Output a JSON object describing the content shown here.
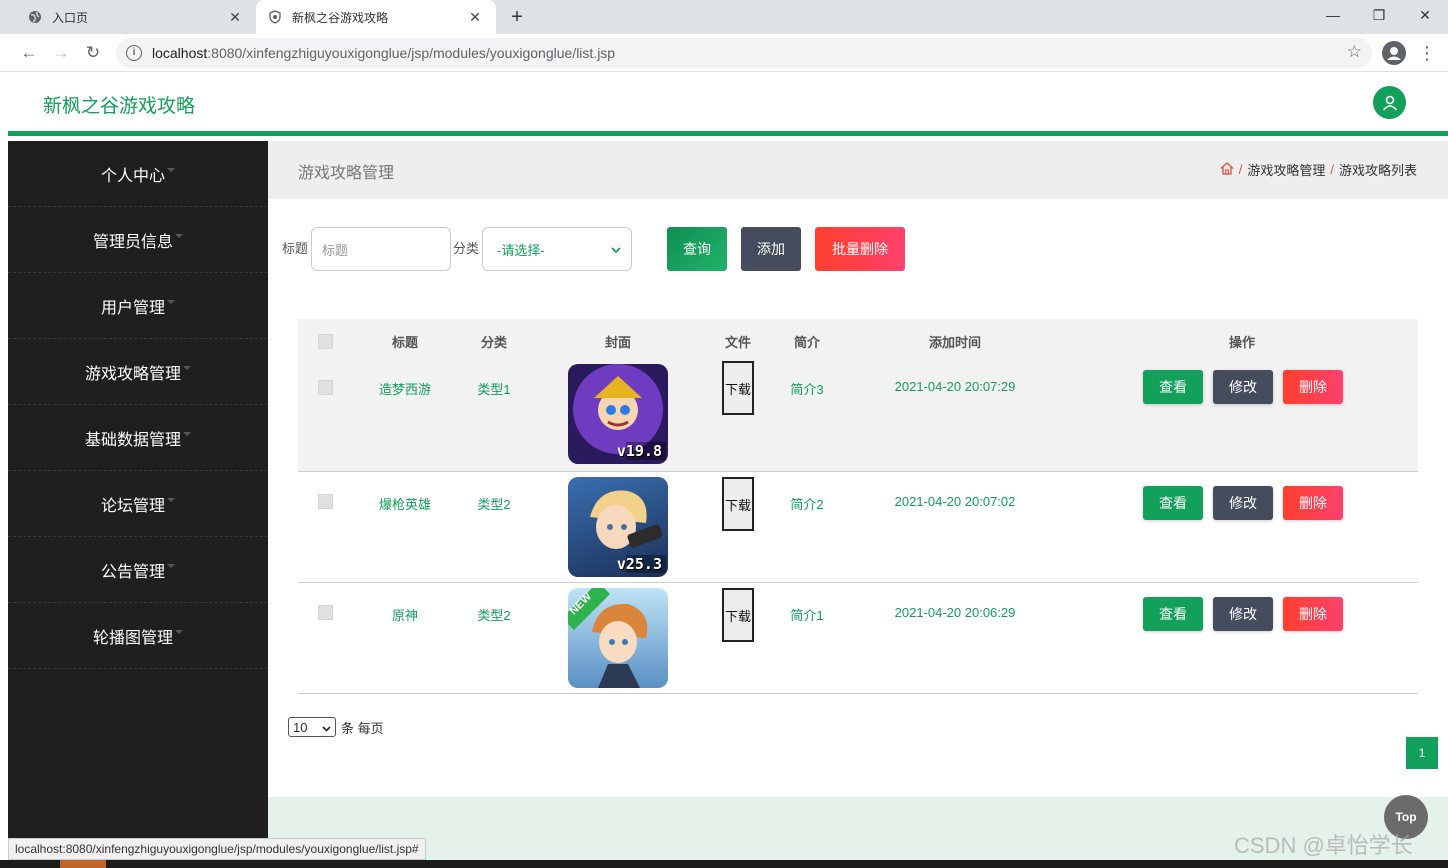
{
  "browser": {
    "tabs": [
      {
        "label": "入口页",
        "active": false
      },
      {
        "label": "新枫之谷游戏攻略",
        "active": true
      }
    ],
    "url_host": "localhost",
    "url_rest": ":8080/xinfengzhiguyouxigonglue/jsp/modules/youxigonglue/list.jsp",
    "status_url": "localhost:8080/xinfengzhiguyouxigonglue/jsp/modules/youxigonglue/list.jsp#"
  },
  "header": {
    "app_title": "新枫之谷游戏攻略"
  },
  "sidebar": {
    "items": [
      {
        "label": "个人中心"
      },
      {
        "label": "管理员信息"
      },
      {
        "label": "用户管理"
      },
      {
        "label": "游戏攻略管理"
      },
      {
        "label": "基础数据管理"
      },
      {
        "label": "论坛管理"
      },
      {
        "label": "公告管理"
      },
      {
        "label": "轮播图管理"
      }
    ]
  },
  "page": {
    "title": "游戏攻略管理",
    "breadcrumb": [
      "游戏攻略管理",
      "游戏攻略列表"
    ]
  },
  "search": {
    "title_label": "标题",
    "title_placeholder": "标题",
    "category_label": "分类",
    "category_value": "-请选择-",
    "query_button": "查询",
    "add_button": "添加",
    "batch_delete_button": "批量删除"
  },
  "table": {
    "headers": [
      "标题",
      "分类",
      "封面",
      "文件",
      "简介",
      "添加时间",
      "操作"
    ],
    "download_label": "下载",
    "actions": {
      "view": "查看",
      "edit": "修改",
      "delete": "删除"
    },
    "rows": [
      {
        "title": "造梦西游",
        "category": "类型1",
        "cover_badge": "v19.8",
        "summary": "简介3",
        "added": "2021-04-20 20:07:29"
      },
      {
        "title": "爆枪英雄",
        "category": "类型2",
        "cover_badge": "v25.3",
        "summary": "简介2",
        "added": "2021-04-20 20:07:02"
      },
      {
        "title": "原神",
        "category": "类型2",
        "cover_badge": "NEW",
        "summary": "简介1",
        "added": "2021-04-20 20:06:29"
      }
    ]
  },
  "pagination": {
    "page_size": "10",
    "per_page_text": "条 每页",
    "current_page": "1"
  },
  "misc": {
    "top_button": "Top",
    "watermark": "CSDN @卓怡学长"
  },
  "colors": {
    "brand_green": "#13a05a",
    "sidebar_bg": "#1f1f1f",
    "edit_gray": "#454c5d",
    "delete_red": "#ff3f2e"
  }
}
